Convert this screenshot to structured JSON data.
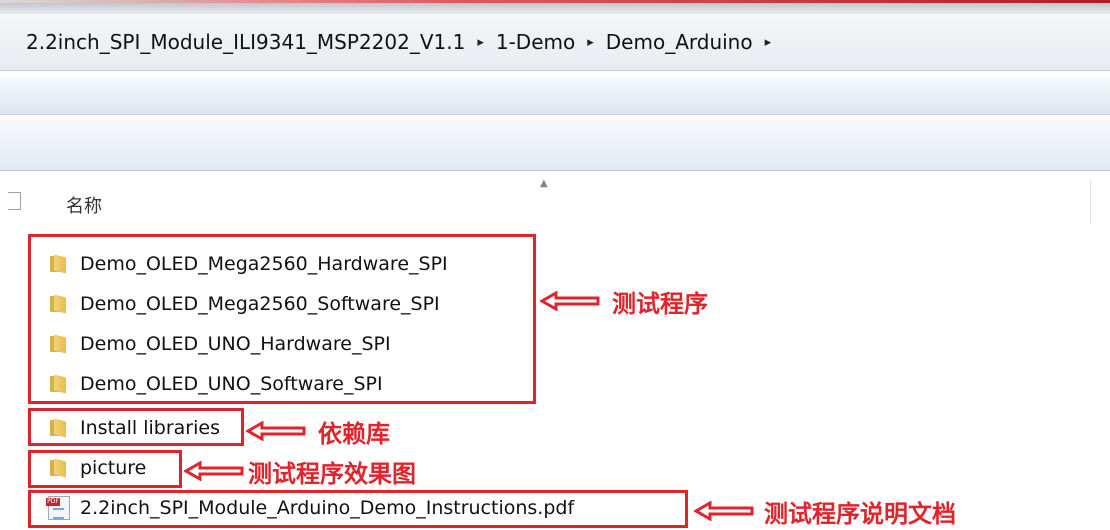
{
  "breadcrumb": [
    "2.2inch_SPI_Module_ILI9341_MSP2202_V1.1",
    "1-Demo",
    "Demo_Arduino"
  ],
  "breadcrumb_separator": "▸",
  "column_header": {
    "name": "名称"
  },
  "files": [
    {
      "name": "Demo_OLED_Mega2560_Hardware_SPI",
      "type": "folder"
    },
    {
      "name": "Demo_OLED_Mega2560_Software_SPI",
      "type": "folder"
    },
    {
      "name": "Demo_OLED_UNO_Hardware_SPI",
      "type": "folder"
    },
    {
      "name": "Demo_OLED_UNO_Software_SPI",
      "type": "folder"
    },
    {
      "name": "Install libraries",
      "type": "folder"
    },
    {
      "name": "picture",
      "type": "folder"
    },
    {
      "name": "2.2inch_SPI_Module_Arduino_Demo_Instructions.pdf",
      "type": "pdf"
    }
  ],
  "annotations": {
    "test_programs": "测试程序",
    "dependency_library": "依赖库",
    "test_effect_picture": "测试程序效果图",
    "instructions_doc": "测试程序说明文档"
  },
  "colors": {
    "annotation": "#e0242c",
    "folder": "#e8bd4c"
  },
  "icons": {
    "folder": "folder-icon",
    "pdf": "pdf-file-icon",
    "separator": "chevron-right-icon",
    "sort": "sort-up-icon"
  }
}
